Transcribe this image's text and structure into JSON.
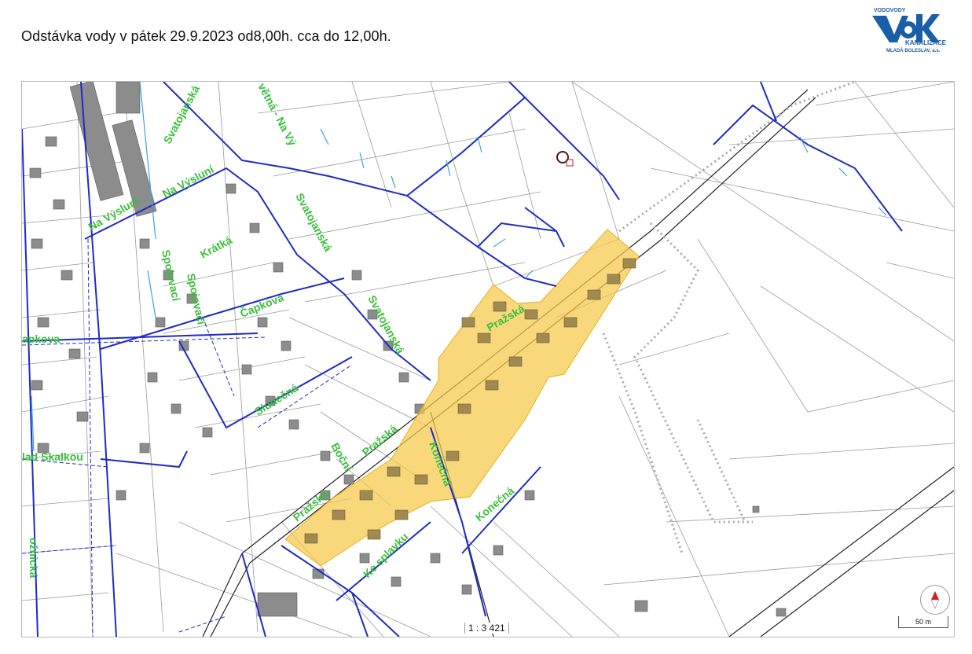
{
  "header": {
    "title": "Odstávka vody v pátek 29.9.2023  od8,00h. cca do 12,00h."
  },
  "logo": {
    "top_text": "VODOVODY",
    "letters": "VaK",
    "text": "KANALIZACE",
    "city": "MLADÁ BOLESLAV, a.s."
  },
  "map": {
    "scale_ratio": "1 : 3 421",
    "scale_bar_label": "50 m",
    "outage_area_color": "#f6c94a",
    "water_main_color": "#1d2bc7",
    "street_label_color": "#3bbf3b",
    "streets": [
      {
        "name": "Svatojanská"
      },
      {
        "name": "Na Výsluní"
      },
      {
        "name": "Na Výsluní"
      },
      {
        "name": "Spojovací"
      },
      {
        "name": "Krátká"
      },
      {
        "name": "Spojovací"
      },
      {
        "name": "Čapkova"
      },
      {
        "name": "Svatojanská"
      },
      {
        "name": "Svatojanská"
      },
      {
        "name": "apkova"
      },
      {
        "name": "Slunečná"
      },
      {
        "name": "Pražská"
      },
      {
        "name": "Boční"
      },
      {
        "name": "Pražská"
      },
      {
        "name": "Konečná"
      },
      {
        "name": "Pražská"
      },
      {
        "name": "Konečná"
      },
      {
        "name": "Ke splavku"
      },
      {
        "name": "lad Skalkou"
      },
      {
        "name": "ožnická"
      },
      {
        "name": "větná - Na Vý"
      }
    ]
  }
}
